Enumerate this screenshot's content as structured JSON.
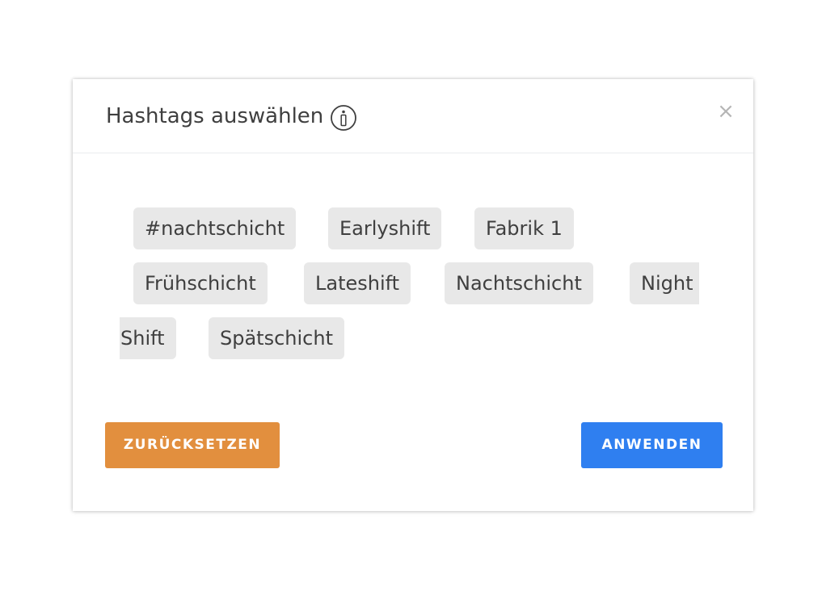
{
  "dialog": {
    "title": "Hashtags auswählen",
    "info_icon": "info-circle-icon",
    "close_label": "×"
  },
  "tags": [
    "#nachtschicht",
    "Earlyshift",
    "Fabrik 1",
    "Frühschicht",
    "Lateshift",
    "Nachtschicht",
    "Night Shift",
    "Spätschicht"
  ],
  "tag_display": {
    "night_part1": "Night",
    "night_part2": "Shift"
  },
  "buttons": {
    "reset_label": "ZURÜCKSETZEN",
    "apply_label": "ANWENDEN"
  },
  "colors": {
    "reset": "#e28f3e",
    "apply": "#2f7ff0",
    "tag_bg": "#e8e8e8"
  }
}
